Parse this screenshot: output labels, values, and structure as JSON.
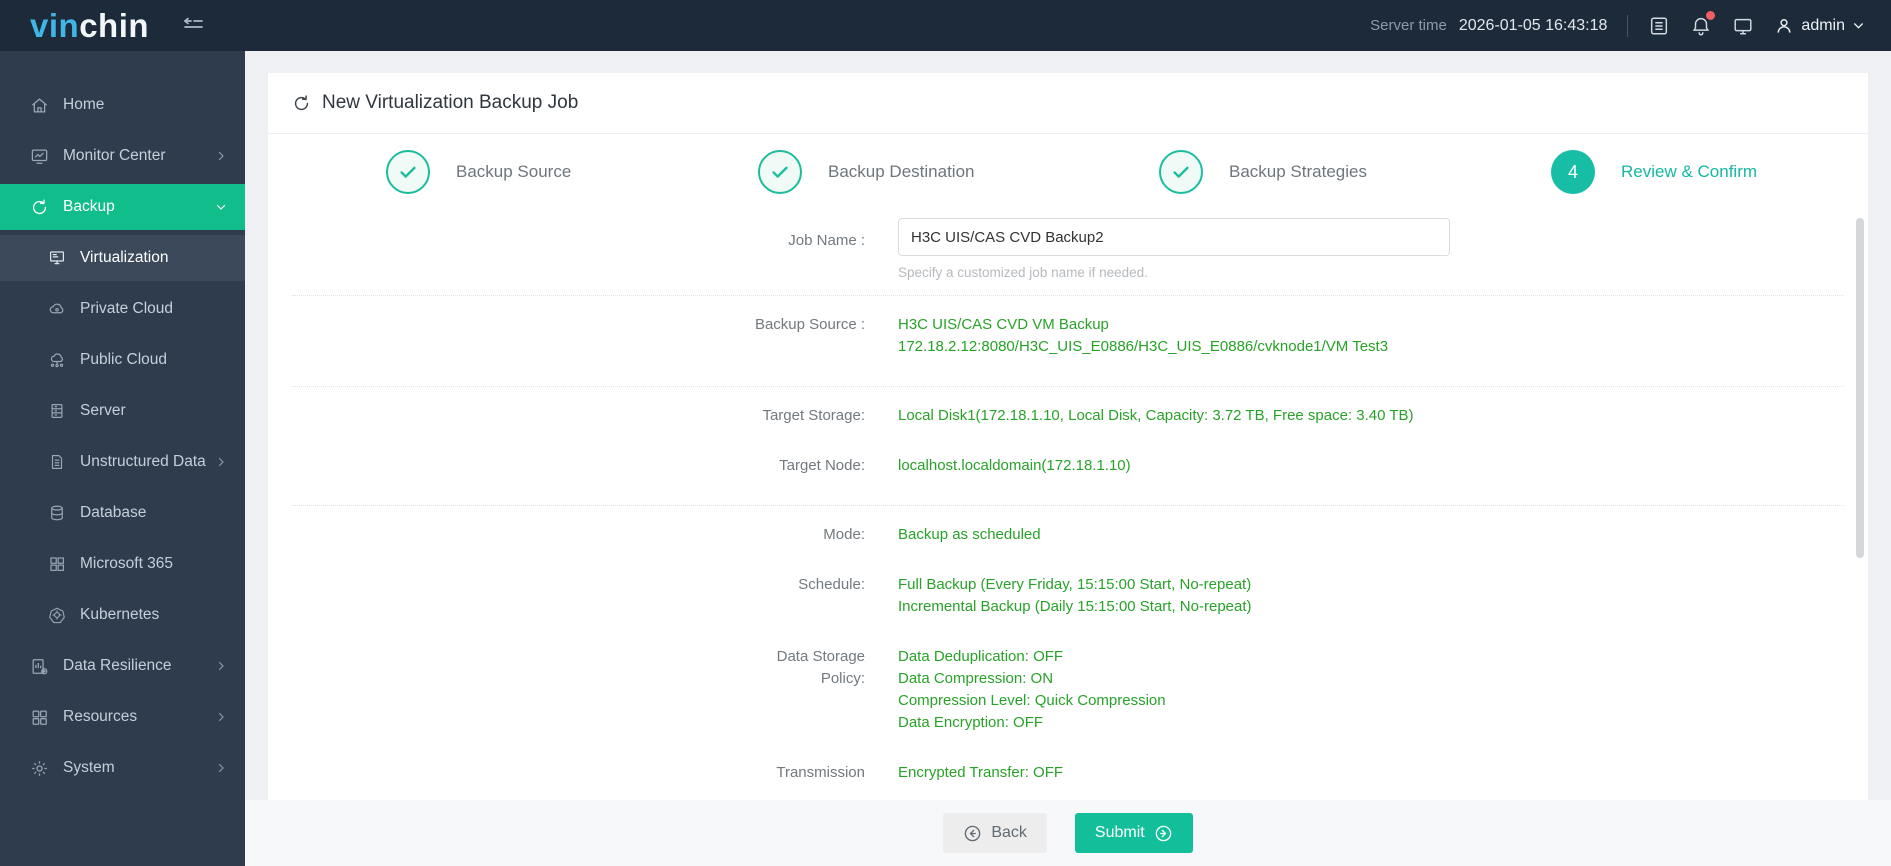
{
  "colors": {
    "topbar_bg": "#1d2a39",
    "sidebar_bg": "#2e3c4e",
    "accent_green": "#10bd8b",
    "accent_teal": "#15b8a2",
    "value_green": "#28a228",
    "badge_red": "#f05f5f"
  },
  "header": {
    "logo_primary": "vin",
    "logo_secondary": "chin",
    "server_time_label": "Server time",
    "server_time": "2026-01-05 16:43:18",
    "username": "admin"
  },
  "sidebar": {
    "items": [
      {
        "label": "Home"
      },
      {
        "label": "Monitor Center"
      },
      {
        "label": "Backup"
      },
      {
        "label": "Virtualization"
      },
      {
        "label": "Private Cloud"
      },
      {
        "label": "Public Cloud"
      },
      {
        "label": "Server"
      },
      {
        "label": "Unstructured Data"
      },
      {
        "label": "Database"
      },
      {
        "label": "Microsoft 365"
      },
      {
        "label": "Kubernetes"
      },
      {
        "label": "Data Resilience"
      },
      {
        "label": "Resources"
      },
      {
        "label": "System"
      }
    ]
  },
  "page": {
    "title": "New Virtualization Backup Job",
    "steps": [
      {
        "label": "Backup Source",
        "state": "done"
      },
      {
        "label": "Backup Destination",
        "state": "done"
      },
      {
        "label": "Backup Strategies",
        "state": "done"
      },
      {
        "label": "Review & Confirm",
        "state": "current",
        "number": "4"
      }
    ]
  },
  "form": {
    "job_name_label": "Job Name :",
    "job_name_value": "H3C UIS/CAS CVD Backup2",
    "job_name_hint": "Specify a customized job name if needed.",
    "rows": [
      {
        "label": "Backup Source :",
        "lines": [
          "H3C UIS/CAS CVD VM Backup",
          "172.18.2.12:8080/H3C_UIS_E0886/H3C_UIS_E0886/cvknode1/VM Test3"
        ]
      },
      {
        "label": "Target Storage:",
        "lines": [
          "Local Disk1(172.18.1.10, Local Disk, Capacity: 3.72 TB, Free space: 3.40 TB)"
        ]
      },
      {
        "label": "Target Node:",
        "lines": [
          "localhost.localdomain(172.18.1.10)"
        ]
      },
      {
        "label": "Mode:",
        "lines": [
          "Backup as scheduled"
        ]
      },
      {
        "label": "Schedule:",
        "lines": [
          "Full Backup (Every Friday, 15:15:00 Start, No-repeat)",
          "Incremental Backup (Daily 15:15:00 Start, No-repeat)"
        ]
      },
      {
        "label": "Data Storage Policy:",
        "lines": [
          "Data Deduplication: OFF",
          "Data Compression: ON",
          "Compression Level: Quick Compression",
          "Data Encryption: OFF"
        ]
      },
      {
        "label": "Transmission",
        "lines": [
          "Encrypted Transfer: OFF"
        ]
      }
    ]
  },
  "footer": {
    "back_label": "Back",
    "submit_label": "Submit"
  }
}
